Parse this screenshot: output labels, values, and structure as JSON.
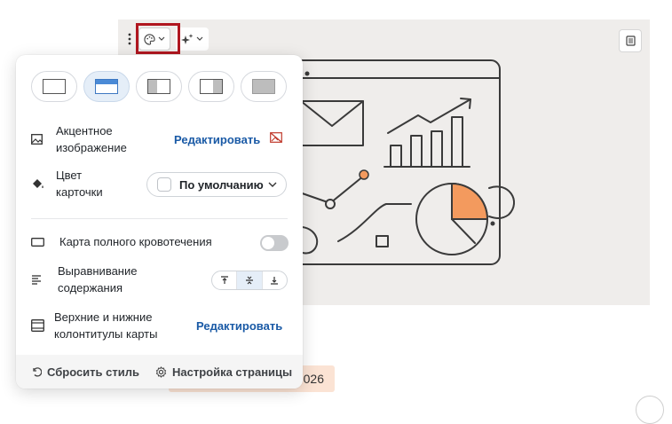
{
  "toolbar": {
    "drag_icon": "drag-handle-icon",
    "style_icon": "palette-icon",
    "ai_icon": "sparkle-icon",
    "doc_icon": "document-icon"
  },
  "card": {
    "tag_text": "026"
  },
  "panel": {
    "layouts": [
      "layout-blank",
      "layout-top-image",
      "layout-left-image",
      "layout-right-image",
      "layout-full-image"
    ],
    "selected_layout": 1,
    "accent": {
      "label": "Акцентное изображение",
      "action": "Редактировать"
    },
    "card_color": {
      "label": "Цвет карточки",
      "value": "По умолчанию"
    },
    "full_bleed": {
      "label": "Карта полного кровотечения",
      "enabled": false
    },
    "alignment": {
      "label": "Выравнивание содержания",
      "options": [
        "top",
        "middle",
        "bottom"
      ],
      "selected": "middle"
    },
    "headers_footers": {
      "label": "Верхние и нижние колонтитулы карты",
      "action": "Редактировать"
    },
    "footer": {
      "reset": "Сбросить стиль",
      "settings": "Настройка страницы"
    }
  },
  "colors": {
    "accent_link": "#1a5aa6",
    "highlight": "#b0161f",
    "illustration_bg": "#efedeb",
    "chart_orange": "#f39a5e"
  }
}
